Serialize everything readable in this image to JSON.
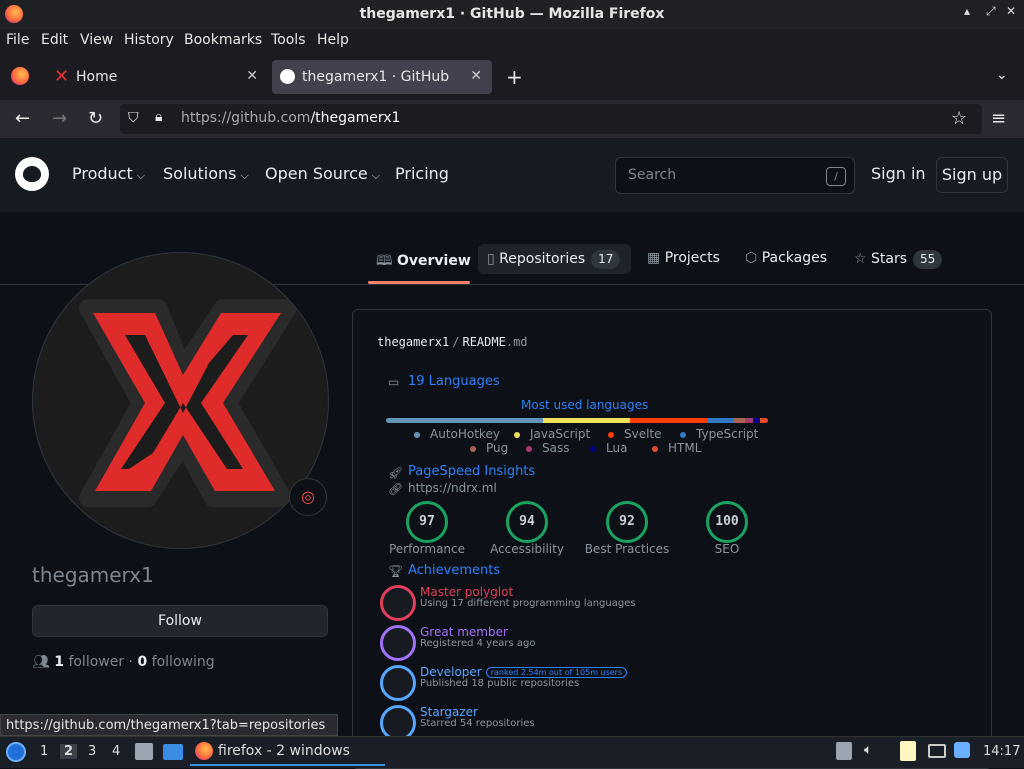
{
  "window": {
    "title": "thegamerx1 · GitHub — Mozilla Firefox"
  },
  "menu": [
    "File",
    "Edit",
    "View",
    "History",
    "Bookmarks",
    "Tools",
    "Help"
  ],
  "tabs": [
    {
      "label": "Home"
    },
    {
      "label": "thegamerx1 · GitHub"
    }
  ],
  "url": {
    "host": "https://github.com",
    "path": "/thegamerx1"
  },
  "github": {
    "nav": [
      "Product",
      "Solutions",
      "Open Source",
      "Pricing"
    ],
    "search_placeholder": "Search",
    "search_key": "/",
    "signin": "Sign in",
    "signup": "Sign up"
  },
  "profile_tabs": {
    "overview": "Overview",
    "repositories": "Repositories",
    "repositories_count": "17",
    "projects": "Projects",
    "packages": "Packages",
    "stars": "Stars",
    "stars_count": "55"
  },
  "profile": {
    "username": "thegamerx1",
    "follow": "Follow",
    "followers_count": "1",
    "followers_label": "follower",
    "following_count": "0",
    "following_label": "following"
  },
  "readme": {
    "path_user": "thegamerx1",
    "path_sep": "/",
    "path_file": "README",
    "path_ext": ".md",
    "languages_title": "19 Languages",
    "most_used": "Most used languages",
    "languages": [
      {
        "name": "AutoHotkey",
        "color": "#6594b9"
      },
      {
        "name": "JavaScript",
        "color": "#f1e05a"
      },
      {
        "name": "Svelte",
        "color": "#ff3e00"
      },
      {
        "name": "TypeScript",
        "color": "#3178c6"
      },
      {
        "name": "Pug",
        "color": "#a86454"
      },
      {
        "name": "Sass",
        "color": "#a53b70"
      },
      {
        "name": "Lua",
        "color": "#000080"
      },
      {
        "name": "HTML",
        "color": "#e34c26"
      }
    ],
    "pagespeed_title": "PageSpeed Insights",
    "pagespeed_url": "https://ndrx.ml",
    "scores": [
      {
        "value": "97",
        "label": "Performance"
      },
      {
        "value": "94",
        "label": "Accessibility"
      },
      {
        "value": "92",
        "label": "Best Practices"
      },
      {
        "value": "100",
        "label": "SEO"
      }
    ],
    "achievements_title": "Achievements",
    "achievements": [
      {
        "title": "Master polyglot",
        "sub": "Using 17 different programming languages",
        "color": "#e03f5a"
      },
      {
        "title": "Great member",
        "sub": "Registered 4 years ago",
        "color": "#a371f7"
      },
      {
        "title": "Developer",
        "badge": "ranked 2.54m out of 105m users",
        "sub": "Published 18 public repositories",
        "color": "#58a6ff"
      },
      {
        "title": "Stargazer",
        "sub": "Starred 54 repositories",
        "color": "#58a6ff"
      }
    ]
  },
  "status_url": "https://github.com/thegamerx1?tab=repositories",
  "taskbar": {
    "workspaces": [
      "1",
      "2",
      "3",
      "4"
    ],
    "app": "firefox - 2 windows",
    "clock": "14:17"
  }
}
